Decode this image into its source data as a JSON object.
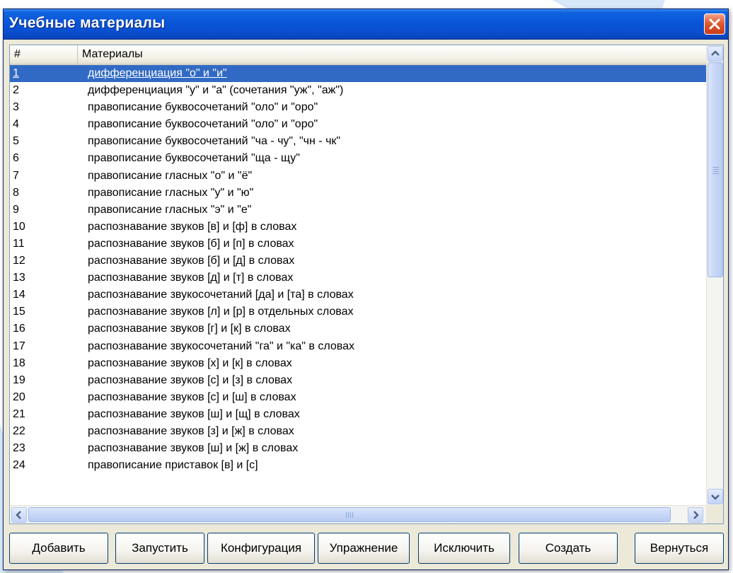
{
  "window": {
    "title": "Учебные материалы"
  },
  "list": {
    "columns": {
      "number": "#",
      "materials": "Материалы"
    },
    "selected_index": 0,
    "rows": [
      {
        "n": "1",
        "text": "дифференциация \"о\" и \"и\""
      },
      {
        "n": "2",
        "text": "дифференциация \"у\" и \"а\" (сочетания \"уж\", \"аж\")"
      },
      {
        "n": "3",
        "text": "правописание буквосочетаний \"оло\" и \"оро\""
      },
      {
        "n": "4",
        "text": "правописание буквосочетаний \"оло\" и \"оро\""
      },
      {
        "n": "5",
        "text": "правописание буквосочетаний \"ча - чу\", \"чн - чк\""
      },
      {
        "n": "6",
        "text": "правописание буквосочетаний \"ща - щу\""
      },
      {
        "n": "7",
        "text": "правописание гласных \"о\" и \"ё\""
      },
      {
        "n": "8",
        "text": "правописание гласных \"у\" и \"ю\""
      },
      {
        "n": "9",
        "text": "правописание гласных \"э\" и \"е\""
      },
      {
        "n": "10",
        "text": "распознавание звуков [в] и [ф] в словах"
      },
      {
        "n": "11",
        "text": "распознавание звуков [б] и [п] в словах"
      },
      {
        "n": "12",
        "text": "распознавание звуков [б] и [д] в словах"
      },
      {
        "n": "13",
        "text": "распознавание звуков [д] и [т] в словах"
      },
      {
        "n": "14",
        "text": "распознавание звукосочетаний [да] и [та] в словах"
      },
      {
        "n": "15",
        "text": "распознавание звуков [л] и [р] в отдельных словах"
      },
      {
        "n": "16",
        "text": "распознавание звуков [г] и [к] в словах"
      },
      {
        "n": "17",
        "text": "распознавание звукосочетаний \"га\" и \"ка\" в словах"
      },
      {
        "n": "18",
        "text": "распознавание звуков [х] и [к] в словах"
      },
      {
        "n": "19",
        "text": "распознавание звуков [с] и [з] в словах"
      },
      {
        "n": "20",
        "text": "распознавание звуков [с] и [ш] в словах"
      },
      {
        "n": "21",
        "text": "распознавание звуков [ш] и [щ] в словах"
      },
      {
        "n": "22",
        "text": "распознавание звуков [з] и [ж] в словах"
      },
      {
        "n": "23",
        "text": "распознавание звуков [ш] и [ж] в словах"
      },
      {
        "n": "24",
        "text": "правописание приставок [в] и [с]"
      }
    ]
  },
  "buttons": {
    "add": "Добавить",
    "run": "Запустить",
    "config": "Конфигурация",
    "exercise": "Упражнение",
    "exclude": "Исключить",
    "create": "Создать",
    "back": "Вернуться"
  },
  "icons": {
    "close": "close-icon",
    "scroll_up": "arrow-up-icon",
    "scroll_down": "arrow-down-icon",
    "scroll_left": "arrow-left-icon",
    "scroll_right": "arrow-right-icon"
  },
  "colors": {
    "titlebar": "#0a55d8",
    "selection": "#316ac5",
    "close_button": "#e05a32",
    "window_face": "#ece9d8"
  }
}
